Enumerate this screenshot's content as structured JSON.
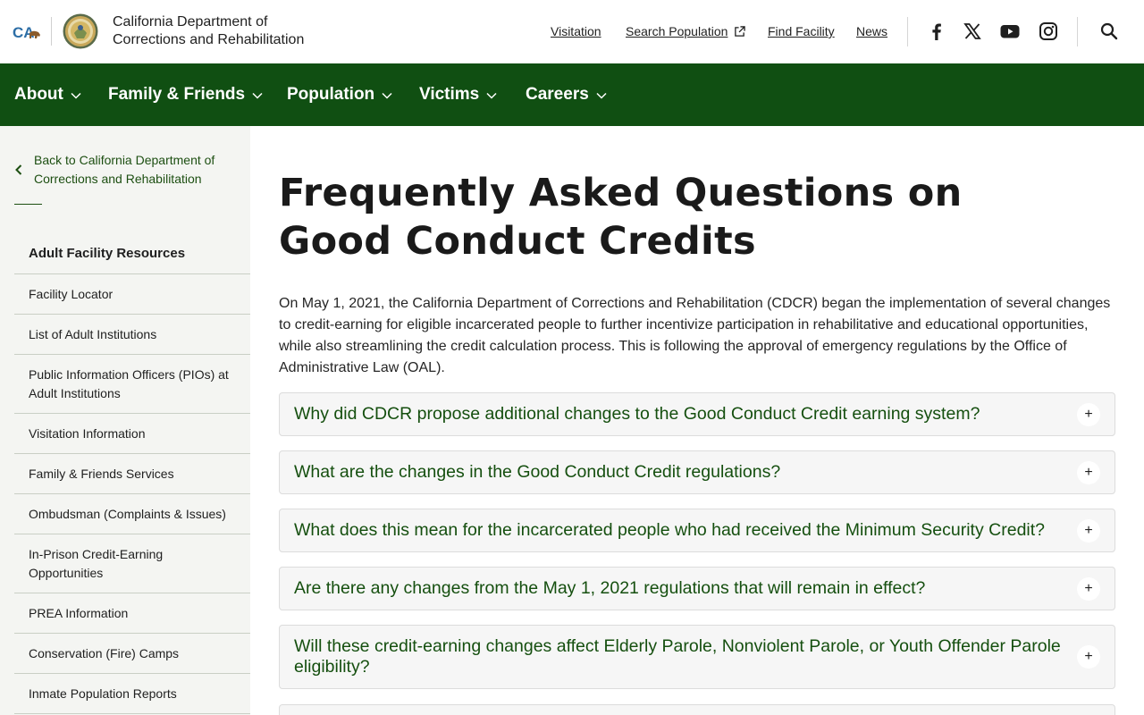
{
  "header": {
    "org_line1": "California Department of",
    "org_line2": "Corrections and Rehabilitation",
    "ca_logo_text": "CA",
    "utility_links": [
      {
        "label": "Visitation"
      },
      {
        "label": "Search Population",
        "icon": "external-link-icon"
      },
      {
        "label": "Find Facility"
      },
      {
        "label": "News"
      }
    ],
    "social_icons": [
      "facebook-icon",
      "x-icon",
      "youtube-icon",
      "instagram-icon"
    ],
    "search_icon": "search-icon"
  },
  "main_nav": {
    "items": [
      {
        "label": "About"
      },
      {
        "label": "Family & Friends"
      },
      {
        "label": "Population"
      },
      {
        "label": "Victims"
      },
      {
        "label": "Careers"
      }
    ]
  },
  "sidebar": {
    "back_line1": "Back to California Department of",
    "back_line2": "Corrections and Rehabilitation",
    "heading": "Adult Facility Resources",
    "items": [
      {
        "label": "Facility Locator"
      },
      {
        "label": "List of Adult Institutions"
      },
      {
        "label": "Public Information Officers (PIOs) at Adult Institutions"
      },
      {
        "label": "Visitation Information"
      },
      {
        "label": "Family & Friends Services"
      },
      {
        "label": "Ombudsman (Complaints & Issues)"
      },
      {
        "label": "In-Prison Credit-Earning Opportunities"
      },
      {
        "label": "PREA Information"
      },
      {
        "label": "Conservation (Fire) Camps"
      },
      {
        "label": "Inmate Population Reports"
      }
    ]
  },
  "content": {
    "title_line1": "Frequently Asked Questions on",
    "title_line2": "Good Conduct Credits",
    "intro": "On May 1, 2021, the California Department of Corrections and Rehabilitation (CDCR) began the implementation of several changes to credit-earning for eligible incarcerated people to further incentivize participation in rehabilitative and educational opportunities, while also streamlining the credit calculation process. This is following the approval of emergency regulations by the Office of Administrative Law (OAL).",
    "faqs": [
      {
        "question": "Why did CDCR propose additional changes to the Good Conduct Credit earning system?"
      },
      {
        "question": "What are the changes in the Good Conduct Credit regulations?"
      },
      {
        "question": "What does this mean for the incarcerated people who had received the Minimum Security Credit?"
      },
      {
        "question": "Are there any changes from the May 1, 2021 regulations that will remain in effect?"
      },
      {
        "question": "Will these credit-earning changes affect Elderly Parole, Nonviolent Parole, or Youth Offender Parole eligibility?"
      }
    ],
    "expand_symbol": "+"
  },
  "colors": {
    "nav_green": "#104f12",
    "link_green": "#154f0f",
    "sidebar_bg": "#f4f5f2"
  }
}
